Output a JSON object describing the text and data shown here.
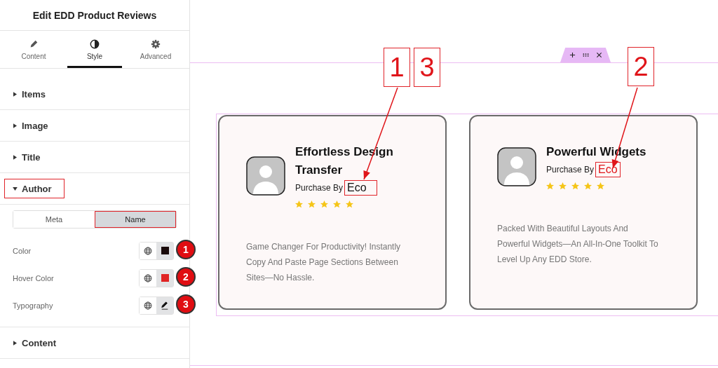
{
  "panel": {
    "title": "Edit EDD Product Reviews",
    "tabs": [
      {
        "label": "Content",
        "selected": false
      },
      {
        "label": "Style",
        "selected": true
      },
      {
        "label": "Advanced",
        "selected": false
      }
    ],
    "sections": [
      {
        "label": "Items",
        "expanded": false,
        "highlighted": false
      },
      {
        "label": "Image",
        "expanded": false,
        "highlighted": false
      },
      {
        "label": "Title",
        "expanded": false,
        "highlighted": false
      },
      {
        "label": "Author",
        "expanded": true,
        "highlighted": true
      },
      {
        "label": "Content",
        "expanded": false,
        "highlighted": false
      }
    ],
    "author_toggle": [
      {
        "label": "Meta",
        "selected": false,
        "highlighted": false
      },
      {
        "label": "Name",
        "selected": true,
        "highlighted": true
      }
    ],
    "author_controls": [
      {
        "label": "Color",
        "kind": "swatch",
        "color": "#1a0a0a",
        "badge": "1"
      },
      {
        "label": "Hover Color",
        "kind": "swatch",
        "color": "#e02424",
        "badge": "2"
      },
      {
        "label": "Typography",
        "kind": "edit",
        "badge": "3"
      }
    ]
  },
  "cards": [
    {
      "title": "Effortless Design Transfer",
      "byline": "Purchase By",
      "author": "Eco",
      "hovered": false,
      "stars": 5,
      "text": "Game Changer For Productivity! Instantly Copy And Paste Page Sections Between Sites—No Hassle.",
      "callouts": [
        "1",
        "3"
      ]
    },
    {
      "title": "Powerful Widgets",
      "byline": "Purchase By",
      "author": "Eco",
      "hovered": true,
      "stars": 5,
      "text": "Packed With Beautiful Layouts And Powerful Widgets—An All-In-One Toolkit To Level Up Any EDD Store.",
      "callouts": [
        "2"
      ]
    }
  ]
}
